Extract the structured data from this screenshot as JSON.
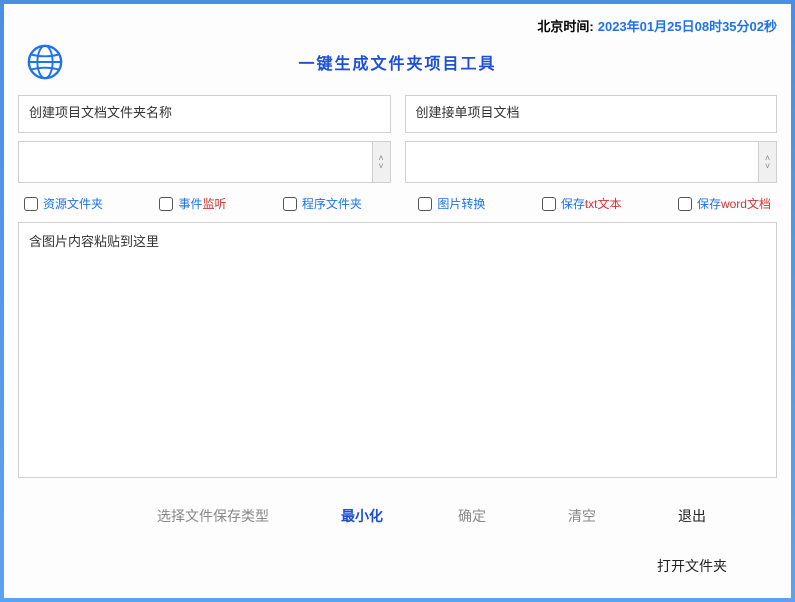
{
  "time": {
    "label": "北京时间:",
    "value": "2023年01月25日08时35分02秒"
  },
  "title": "一键生成文件夹项目工具",
  "inputs": {
    "left_placeholder": "创建项目文档文件夹名称",
    "right_placeholder": "创建接单项目文档"
  },
  "checks": {
    "c1": "资源文件夹",
    "c2_a": "事件",
    "c2_b": "监听",
    "c3": "程序文件夹",
    "c4": "图片转换",
    "c5_a": "保存",
    "c5_b": "txt文本",
    "c6_a": "保存",
    "c6_b": "word文档"
  },
  "paste_placeholder": "含图片内容粘贴到这里",
  "buttons": {
    "select_type": "选择文件保存类型",
    "minimize": "最小化",
    "confirm": "确定",
    "clear": "清空",
    "exit": "退出",
    "open_folder": "打开文件夹"
  }
}
